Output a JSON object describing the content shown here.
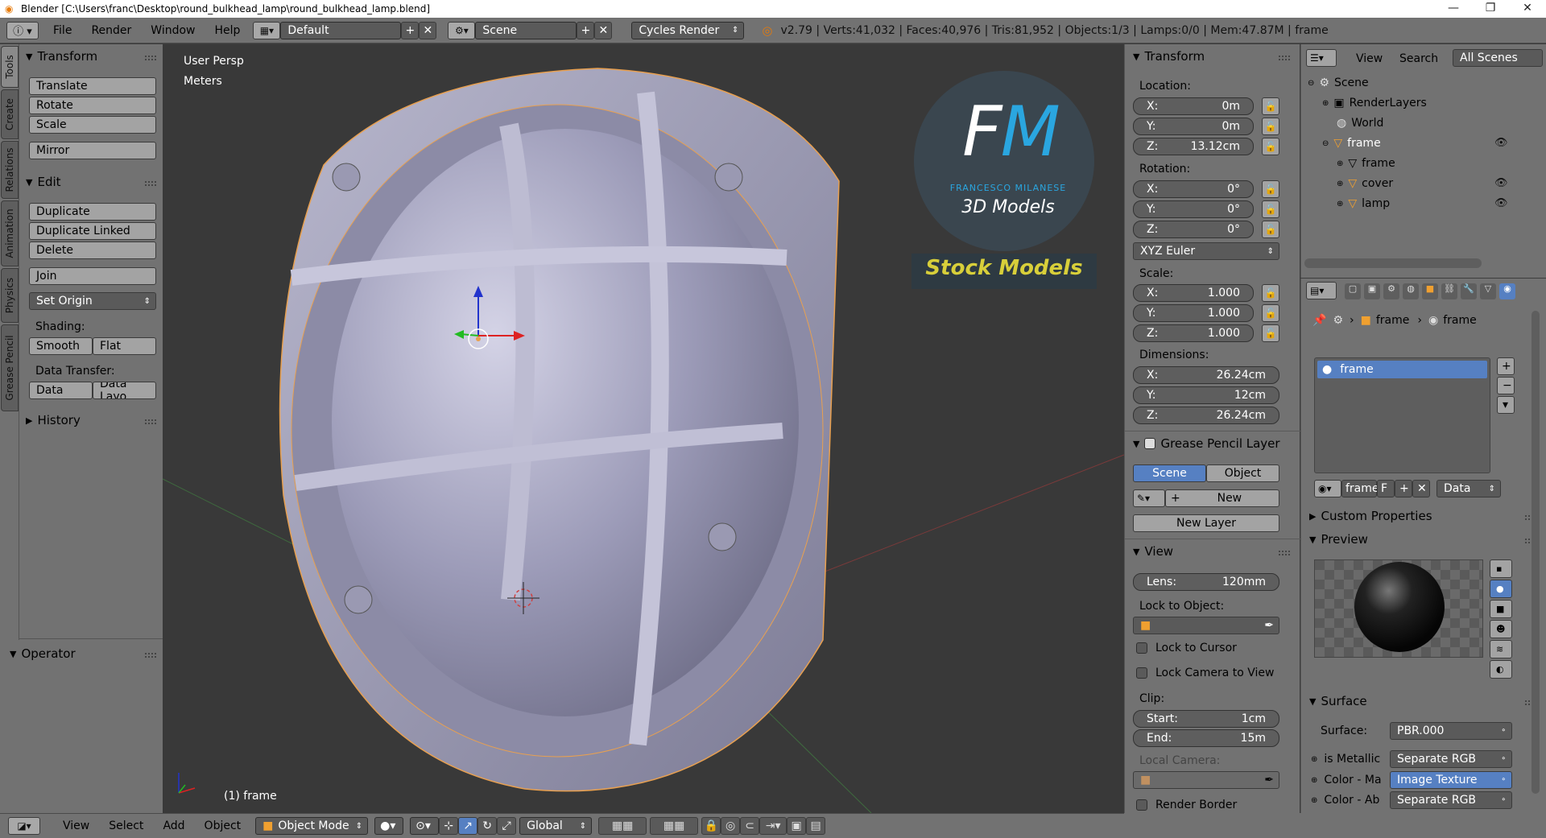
{
  "titlebar": {
    "title": "Blender [C:\\Users\\franc\\Desktop\\round_bulkhead_lamp\\round_bulkhead_lamp.blend]",
    "minimize": "—",
    "maximize": "❐",
    "close": "✕"
  },
  "infobar": {
    "menus": [
      "File",
      "Render",
      "Window",
      "Help"
    ],
    "layout": "Default",
    "scene": "Scene",
    "engine": "Cycles Render",
    "stats": "v2.79 | Verts:41,032 | Faces:40,976 | Tris:81,952 | Objects:1/3 | Lamps:0/0 | Mem:47.87M | frame"
  },
  "tooltabs": [
    "Tools",
    "Create",
    "Relations",
    "Animation",
    "Physics",
    "Grease Pencil"
  ],
  "toolshelf": {
    "transform_title": "Transform",
    "translate": "Translate",
    "rotate": "Rotate",
    "scale": "Scale",
    "mirror": "Mirror",
    "edit_title": "Edit",
    "duplicate": "Duplicate",
    "duplicate_linked": "Duplicate Linked",
    "delete": "Delete",
    "join": "Join",
    "set_origin": "Set Origin",
    "shading_label": "Shading:",
    "smooth": "Smooth",
    "flat": "Flat",
    "data_transfer_label": "Data Transfer:",
    "data": "Data",
    "data_layout": "Data Layo",
    "history_title": "History",
    "operator_title": "Operator"
  },
  "viewport": {
    "view_name": "User Persp",
    "units": "Meters",
    "object_label": "(1) frame",
    "watermark": {
      "logo_f": "F",
      "logo_m": "M",
      "author": "FRANCESCO MILANESE",
      "models": "3D Models",
      "stock": "Stock Models"
    }
  },
  "npanel": {
    "transform_title": "Transform",
    "location_label": "Location:",
    "location": {
      "x": "0m",
      "y": "0m",
      "z": "13.12cm"
    },
    "rotation_label": "Rotation:",
    "rotation": {
      "x": "0°",
      "y": "0°",
      "z": "0°"
    },
    "rotation_mode": "XYZ Euler",
    "scale_label": "Scale:",
    "scale": {
      "x": "1.000",
      "y": "1.000",
      "z": "1.000"
    },
    "dimensions_label": "Dimensions:",
    "dimensions": {
      "x": "26.24cm",
      "y": "12cm",
      "z": "26.24cm"
    },
    "x_label": "X:",
    "y_label": "Y:",
    "z_label": "Z:",
    "grease_pencil_title": "Grease Pencil Layer",
    "gp_scene": "Scene",
    "gp_object": "Object",
    "gp_new": "New",
    "gp_new_layer": "New Layer",
    "view_title": "View",
    "lens_label": "Lens:",
    "lens": "120mm",
    "lock_to_object": "Lock to Object:",
    "lock_to_cursor": "Lock to Cursor",
    "lock_camera": "Lock Camera to View",
    "clip_label": "Clip:",
    "clip_start_label": "Start:",
    "clip_start": "1cm",
    "clip_end_label": "End:",
    "clip_end": "15m",
    "local_camera": "Local Camera:",
    "render_border": "Render Border"
  },
  "outliner": {
    "view": "View",
    "search": "Search",
    "filter": "All Scenes",
    "items": [
      "Scene",
      "RenderLayers",
      "World",
      "frame",
      "frame",
      "cover",
      "lamp"
    ]
  },
  "properties": {
    "breadcrumb_obj": "frame",
    "breadcrumb_mat": "frame",
    "slot": "frame",
    "material_name": "frame",
    "material_users": "F",
    "link": "Data",
    "custom_props": "Custom Properties",
    "preview": "Preview",
    "surface_title": "Surface",
    "surface_label": "Surface:",
    "surface_value": "PBR.000",
    "inputs": [
      {
        "label": "is Metallic",
        "value": "Separate RGB"
      },
      {
        "label": "Color - Ma",
        "value": "Image Texture"
      },
      {
        "label": "Color - Ab",
        "value": "Separate RGB"
      }
    ]
  },
  "bottombar": {
    "view": "View",
    "select": "Select",
    "add": "Add",
    "object": "Object",
    "mode": "Object Mode",
    "orientation": "Global"
  },
  "colors": {
    "panel": "#727272",
    "viewport": "#393939",
    "accent_blue": "#5680c2",
    "object_outline": "#e8a050"
  }
}
